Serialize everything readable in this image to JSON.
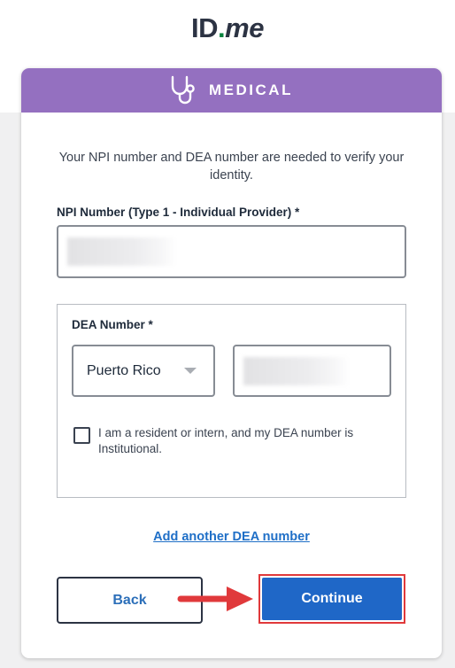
{
  "logo": {
    "id": "ID",
    "dot": ".",
    "me": "me"
  },
  "header": {
    "title": "MEDICAL",
    "icon": "stethoscope-icon",
    "color": "#9470c0"
  },
  "intro_text": "Your NPI number and DEA number are needed to verify your identity.",
  "npi": {
    "label": "NPI Number (Type 1 - Individual Provider) *",
    "value_redacted": true
  },
  "dea": {
    "label": "DEA Number *",
    "state_selected": "Puerto Rico",
    "number_redacted": true,
    "resident_checkbox": {
      "label": "I am a resident or intern, and my DEA number is Institutional.",
      "checked": false
    }
  },
  "add_link": "Add another DEA number",
  "buttons": {
    "back": "Back",
    "continue": "Continue"
  },
  "colors": {
    "primary": "#1f67c7",
    "highlight": "#e0393b",
    "link": "#1f6fc7"
  }
}
